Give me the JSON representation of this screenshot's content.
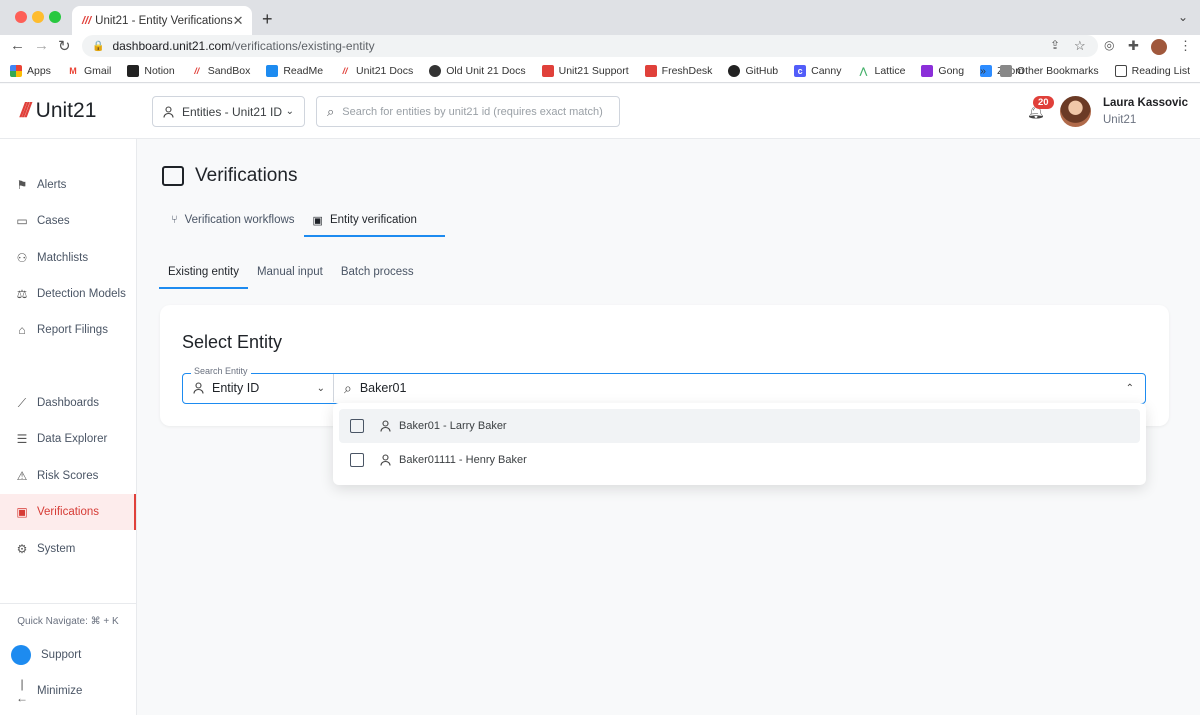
{
  "browser": {
    "tab_title": "Unit21 - Entity Verifications",
    "tab_logo": "///",
    "url_host": "dashboard.unit21.com",
    "url_path": "/verifications/existing-entity",
    "bookmarks": [
      {
        "label": "Apps",
        "icon": "apps-grid-icon",
        "color": "#ea4335"
      },
      {
        "label": "Gmail",
        "icon": "gmail-icon",
        "color": "#ea4335"
      },
      {
        "label": "Notion",
        "icon": "notion-icon",
        "color": "#222222"
      },
      {
        "label": "SandBox",
        "icon": "unit21-icon",
        "color": "#e0403a"
      },
      {
        "label": "ReadMe",
        "icon": "readme-icon",
        "color": "#1d8bf0"
      },
      {
        "label": "Unit21 Docs",
        "icon": "unit21-icon",
        "color": "#e0403a"
      },
      {
        "label": "Old Unit 21 Docs",
        "icon": "globe-icon",
        "color": "#333333"
      },
      {
        "label": "Unit21 Support",
        "icon": "unit21-icon",
        "color": "#e0403a"
      },
      {
        "label": "FreshDesk",
        "icon": "freshdesk-icon",
        "color": "#e0403a"
      },
      {
        "label": "GitHub",
        "icon": "github-icon",
        "color": "#222222"
      },
      {
        "label": "Canny",
        "icon": "canny-icon",
        "color": "#525df9"
      },
      {
        "label": "Lattice",
        "icon": "lattice-icon",
        "color": "#47b16c"
      },
      {
        "label": "Gong",
        "icon": "gong-icon",
        "color": "#8b2fd9"
      },
      {
        "label": "Zoom",
        "icon": "zoom-icon",
        "color": "#2d8cff"
      }
    ],
    "overflow": "»",
    "other_bookmarks": "Other Bookmarks",
    "reading_list": "Reading List"
  },
  "header": {
    "logo_mark": "///",
    "logo_text": "Unit21",
    "entity_select": "Entities - Unit21 ID",
    "search_placeholder": "Search for entities by unit21 id (requires exact match)",
    "notification_count": "20",
    "user_name": "Laura Kassovic",
    "user_org": "Unit21"
  },
  "sidebar": {
    "items": [
      {
        "label": "Alerts",
        "icon": "flag-icon"
      },
      {
        "label": "Cases",
        "icon": "briefcase-icon"
      },
      {
        "label": "Matchlists",
        "icon": "user-x-icon"
      },
      {
        "label": "Detection Models",
        "icon": "scale-icon"
      },
      {
        "label": "Report Filings",
        "icon": "bank-icon"
      },
      {
        "label": "Dashboards",
        "icon": "chart-line-icon"
      },
      {
        "label": "Data Explorer",
        "icon": "data-search-icon"
      },
      {
        "label": "Risk Scores",
        "icon": "warning-icon"
      },
      {
        "label": "Verifications",
        "icon": "id-card-icon"
      },
      {
        "label": "System",
        "icon": "gear-icon"
      }
    ],
    "quick_navigate": "Quick Navigate: ⌘ + K",
    "support": "Support",
    "minimize": "Minimize"
  },
  "main": {
    "title": "Verifications",
    "tabs": [
      {
        "label": "Verification workflows",
        "icon": "workflow-icon"
      },
      {
        "label": "Entity verification",
        "icon": "id-card-icon"
      }
    ],
    "subtabs": [
      "Existing entity",
      "Manual input",
      "Batch process"
    ],
    "card": {
      "title": "Select Entity",
      "legend": "Search Entity",
      "search_type": "Entity ID",
      "search_value": "Baker01"
    },
    "results": [
      {
        "label": "Baker01 - Larry Baker"
      },
      {
        "label": "Baker01111 - Henry Baker"
      }
    ]
  }
}
